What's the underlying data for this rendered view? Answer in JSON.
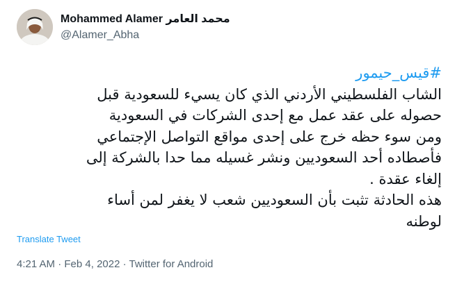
{
  "author": {
    "name": "Mohammed Alamer",
    "name_arabic": "محمد العامر",
    "handle": "@Alamer_Abha"
  },
  "tweet": {
    "hashtag": "#قيس_حيمور",
    "lines": [
      "الشاب الفلسطيني الأردني الذي كان يسيء للسعودية قبل",
      "حصوله على عقد عمل مع إحدى الشركات في السعودية",
      "ومن سوء حظه خرج على إحدى مواقع التواصل الإجتماعي",
      "فأصطاده أحد السعوديين ونشر غسيله مما حدا بالشركة إلى",
      "إلغاء عقدة .",
      "هذه الحادثة تثبت بأن السعوديين شعب لا يغفر لمن أساء",
      "لوطنه"
    ],
    "translate_label": "Translate Tweet"
  },
  "meta": {
    "time": "4:21 AM",
    "separator1": " · ",
    "date": "Feb 4, 2022",
    "separator2": " · ",
    "source": "Twitter for Android"
  },
  "colors": {
    "link": "#1d9bf0",
    "secondary_text": "#536471",
    "primary_text": "#0f1419"
  }
}
